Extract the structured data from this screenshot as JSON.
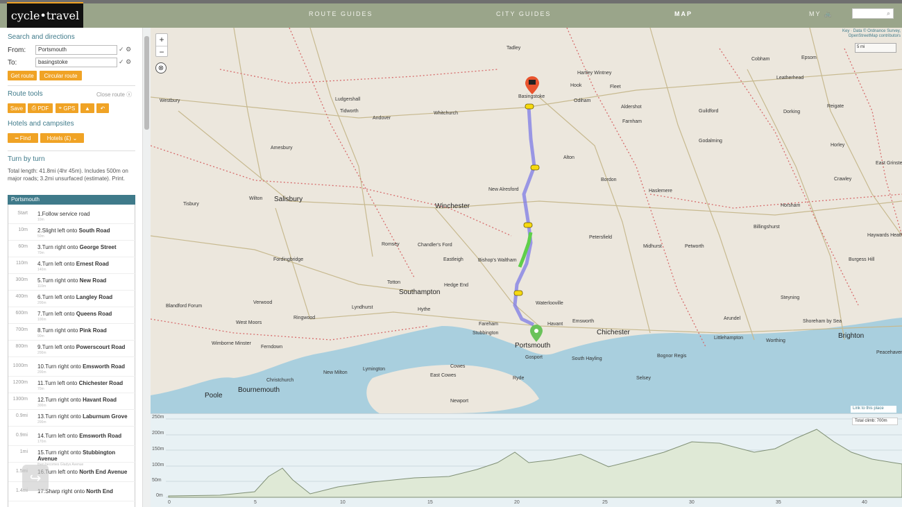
{
  "nav": {
    "logo": "cycle•travel",
    "route_guides": "ROUTE GUIDES",
    "city_guides": "CITY GUIDES",
    "map": "MAP",
    "my": "MY"
  },
  "sidebar": {
    "search_title": "Search and directions",
    "from_label": "From:",
    "from_value": "Portsmouth",
    "to_label": "To:",
    "to_value": "basingstoke",
    "get_route": "Get route",
    "circular_route": "Circular route",
    "route_tools_title": "Route tools",
    "close_route": "Close route",
    "save": "Save",
    "pdf": "PDF",
    "gps": "GPS",
    "hotels_title": "Hotels and campsites",
    "find": "Find",
    "hotels_label": "Hotels (£)",
    "turn_title": "Turn by turn",
    "summary": "Total length: 41.8mi (4hr 45m). Includes 500m on major roads; 3.2mi unsurfaced (estimate). Print.",
    "steps_header": "Portsmouth",
    "steps": [
      {
        "dist": "Start",
        "num": "1.",
        "pre": "Follow service road",
        "road": "",
        "sub": "10m"
      },
      {
        "dist": "10m",
        "num": "2.",
        "pre": "Slight left onto ",
        "road": "South Road",
        "sub": "50m"
      },
      {
        "dist": "60m",
        "num": "3.",
        "pre": "Turn right onto ",
        "road": "George Street",
        "sub": "70m"
      },
      {
        "dist": "110m",
        "num": "4.",
        "pre": "Turn left onto ",
        "road": "Ernest Road",
        "sub": "140m"
      },
      {
        "dist": "300m",
        "num": "5.",
        "pre": "Turn right onto ",
        "road": "New Road",
        "sub": "110m"
      },
      {
        "dist": "400m",
        "num": "6.",
        "pre": "Turn left onto ",
        "road": "Langley Road",
        "sub": "200m"
      },
      {
        "dist": "600m",
        "num": "7.",
        "pre": "Turn left onto ",
        "road": "Queens Road",
        "sub": "100m"
      },
      {
        "dist": "700m",
        "num": "8.",
        "pre": "Turn right onto ",
        "road": "Pink Road",
        "sub": "90m"
      },
      {
        "dist": "800m",
        "num": "9.",
        "pre": "Turn left onto ",
        "road": "Powerscourt Road",
        "sub": "200m"
      },
      {
        "dist": "1000m",
        "num": "10.",
        "pre": "Turn right onto ",
        "road": "Emsworth Road",
        "sub": "200m"
      },
      {
        "dist": "1200m",
        "num": "11.",
        "pre": "Turn left onto ",
        "road": "Chichester Road",
        "sub": "70m"
      },
      {
        "dist": "1300m",
        "num": "12.",
        "pre": "Turn right onto ",
        "road": "Havant Road",
        "sub": "300m"
      },
      {
        "dist": "0.9mi",
        "num": "13.",
        "pre": "Turn right onto ",
        "road": "Laburnum Grove",
        "sub": "200m"
      },
      {
        "dist": "0.9mi",
        "num": "14.",
        "pre": "Turn left onto ",
        "road": "Emsworth Road",
        "sub": "170m"
      },
      {
        "dist": "1mi",
        "num": "15.",
        "pre": "Turn right onto ",
        "road": "Stubbington Avenue",
        "sub": "then becomes Gladys Avenue"
      },
      {
        "dist": "1.5mi",
        "num": "16.",
        "pre": "Turn left onto ",
        "road": "North End Avenue",
        "sub": ""
      },
      {
        "dist": "1.4mi",
        "num": "17.",
        "pre": "Sharp right onto ",
        "road": "North End",
        "sub": ""
      }
    ]
  },
  "map": {
    "attribution": "Key · Data © Ordnance Survey, OpenStreetMap contributors",
    "scale": "5 mi",
    "towns": [
      {
        "name": "Tadley",
        "cls": ""
      },
      {
        "name": "Basingstoke",
        "cls": ""
      },
      {
        "name": "Hartley Wintney",
        "cls": ""
      },
      {
        "name": "Fleet",
        "cls": ""
      },
      {
        "name": "Hook",
        "cls": ""
      },
      {
        "name": "Odiham",
        "cls": ""
      },
      {
        "name": "Ludgershall",
        "cls": ""
      },
      {
        "name": "Tidworth",
        "cls": ""
      },
      {
        "name": "Andover",
        "cls": ""
      },
      {
        "name": "Whitchurch",
        "cls": ""
      },
      {
        "name": "Amesbury",
        "cls": ""
      },
      {
        "name": "Salisbury",
        "cls": "big"
      },
      {
        "name": "Winchester",
        "cls": "big"
      },
      {
        "name": "New Alresford",
        "cls": ""
      },
      {
        "name": "Alton",
        "cls": ""
      },
      {
        "name": "Bordon",
        "cls": ""
      },
      {
        "name": "Haslemere",
        "cls": ""
      },
      {
        "name": "Petersfield",
        "cls": ""
      },
      {
        "name": "Midhurst",
        "cls": ""
      },
      {
        "name": "Petworth",
        "cls": ""
      },
      {
        "name": "Southampton",
        "cls": "big"
      },
      {
        "name": "Eastleigh",
        "cls": ""
      },
      {
        "name": "Bishop's Waltham",
        "cls": ""
      },
      {
        "name": "Hedge End",
        "cls": ""
      },
      {
        "name": "Totton",
        "cls": ""
      },
      {
        "name": "Romsey",
        "cls": ""
      },
      {
        "name": "Chandler's Ford",
        "cls": ""
      },
      {
        "name": "Fordingbridge",
        "cls": ""
      },
      {
        "name": "Ringwood",
        "cls": ""
      },
      {
        "name": "Verwood",
        "cls": ""
      },
      {
        "name": "Lyndhurst",
        "cls": ""
      },
      {
        "name": "Hythe",
        "cls": ""
      },
      {
        "name": "Fareham",
        "cls": ""
      },
      {
        "name": "Stubbington",
        "cls": ""
      },
      {
        "name": "Portsmouth",
        "cls": "big"
      },
      {
        "name": "Gosport",
        "cls": ""
      },
      {
        "name": "Havant",
        "cls": ""
      },
      {
        "name": "Waterlooville",
        "cls": ""
      },
      {
        "name": "Emsworth",
        "cls": ""
      },
      {
        "name": "Chichester",
        "cls": "big"
      },
      {
        "name": "South Hayling",
        "cls": ""
      },
      {
        "name": "Selsey",
        "cls": ""
      },
      {
        "name": "Bognor Regis",
        "cls": ""
      },
      {
        "name": "Arundel",
        "cls": ""
      },
      {
        "name": "Littlehampton",
        "cls": ""
      },
      {
        "name": "Worthing",
        "cls": ""
      },
      {
        "name": "Brighton",
        "cls": "big"
      },
      {
        "name": "Horsham",
        "cls": ""
      },
      {
        "name": "Crawley",
        "cls": ""
      },
      {
        "name": "Guildford",
        "cls": ""
      },
      {
        "name": "Farnham",
        "cls": ""
      },
      {
        "name": "Aldershot",
        "cls": ""
      },
      {
        "name": "Godalming",
        "cls": ""
      },
      {
        "name": "Dorking",
        "cls": ""
      },
      {
        "name": "Reigate",
        "cls": ""
      },
      {
        "name": "Horley",
        "cls": ""
      },
      {
        "name": "East Grinstead",
        "cls": ""
      },
      {
        "name": "Haywards Heath",
        "cls": ""
      },
      {
        "name": "Burgess Hill",
        "cls": ""
      },
      {
        "name": "Poole",
        "cls": "big"
      },
      {
        "name": "Bournemouth",
        "cls": "big"
      },
      {
        "name": "Christchurch",
        "cls": ""
      },
      {
        "name": "New Milton",
        "cls": ""
      },
      {
        "name": "Lymington",
        "cls": ""
      },
      {
        "name": "Cowes",
        "cls": ""
      },
      {
        "name": "East Cowes",
        "cls": ""
      },
      {
        "name": "Ryde",
        "cls": ""
      },
      {
        "name": "Newport",
        "cls": ""
      },
      {
        "name": "Wimborne Minster",
        "cls": ""
      },
      {
        "name": "West Moors",
        "cls": ""
      },
      {
        "name": "Ferndown",
        "cls": ""
      },
      {
        "name": "Blandford Forum",
        "cls": ""
      },
      {
        "name": "Tisbury",
        "cls": ""
      },
      {
        "name": "Wilton",
        "cls": ""
      },
      {
        "name": "Billingshurst",
        "cls": ""
      },
      {
        "name": "Steyning",
        "cls": ""
      },
      {
        "name": "Shoreham by Sea",
        "cls": ""
      },
      {
        "name": "Peacehaven",
        "cls": ""
      },
      {
        "name": "Cobham",
        "cls": ""
      },
      {
        "name": "Leatherhead",
        "cls": ""
      },
      {
        "name": "Epsom",
        "cls": ""
      },
      {
        "name": "Westbury",
        "cls": ""
      }
    ]
  },
  "elevation": {
    "y_labels": [
      "250m",
      "200m",
      "150m",
      "100m",
      "50m",
      "0m"
    ],
    "x_labels": [
      "0",
      "5",
      "10",
      "15",
      "20",
      "25",
      "30",
      "35",
      "40"
    ],
    "link": "Link to this place",
    "total_climb": "Total climb: 700m"
  }
}
